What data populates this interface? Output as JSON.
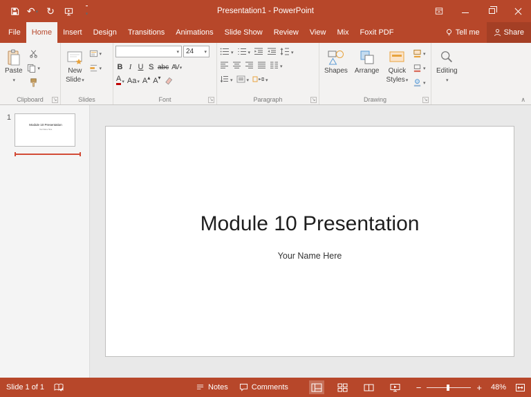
{
  "colors": {
    "accent": "#B7472A",
    "selection_red": "#D24A35"
  },
  "titlebar": {
    "title": "Presentation1 - PowerPoint"
  },
  "icons": {
    "undo": "↶",
    "redo": "↻"
  },
  "tabs": [
    {
      "label": "File"
    },
    {
      "label": "Home"
    },
    {
      "label": "Insert"
    },
    {
      "label": "Design"
    },
    {
      "label": "Transitions"
    },
    {
      "label": "Animations"
    },
    {
      "label": "Slide Show"
    },
    {
      "label": "Review"
    },
    {
      "label": "View"
    },
    {
      "label": "Mix"
    },
    {
      "label": "Foxit PDF"
    }
  ],
  "tellme_label": "Tell me",
  "share_label": "Share",
  "ribbon": {
    "clipboard": {
      "label": "Clipboard",
      "paste": "Paste"
    },
    "slides": {
      "label": "Slides",
      "new_line1": "New",
      "new_line2": "Slide"
    },
    "font": {
      "label": "Font",
      "font_name": "",
      "font_size": "24",
      "bold": "B",
      "italic": "I",
      "underline": "U",
      "shadow": "S",
      "strike": "abc",
      "spacing": "AV",
      "color": "A",
      "case": "Aa",
      "grow": "A",
      "shrink": "A"
    },
    "paragraph": {
      "label": "Paragraph"
    },
    "drawing": {
      "label": "Drawing",
      "shapes": "Shapes",
      "arrange": "Arrange",
      "quick_line1": "Quick",
      "quick_line2": "Styles"
    },
    "editing": {
      "label": "Editing"
    }
  },
  "slides_panel": {
    "slide_number": "1"
  },
  "slide": {
    "title": "Module 10 Presentation",
    "subtitle": "Your Name Here"
  },
  "statusbar": {
    "slide_indicator": "Slide 1 of 1",
    "notes": "Notes",
    "comments": "Comments",
    "zoom_out": "−",
    "zoom_in": "+",
    "zoom": "48%"
  }
}
